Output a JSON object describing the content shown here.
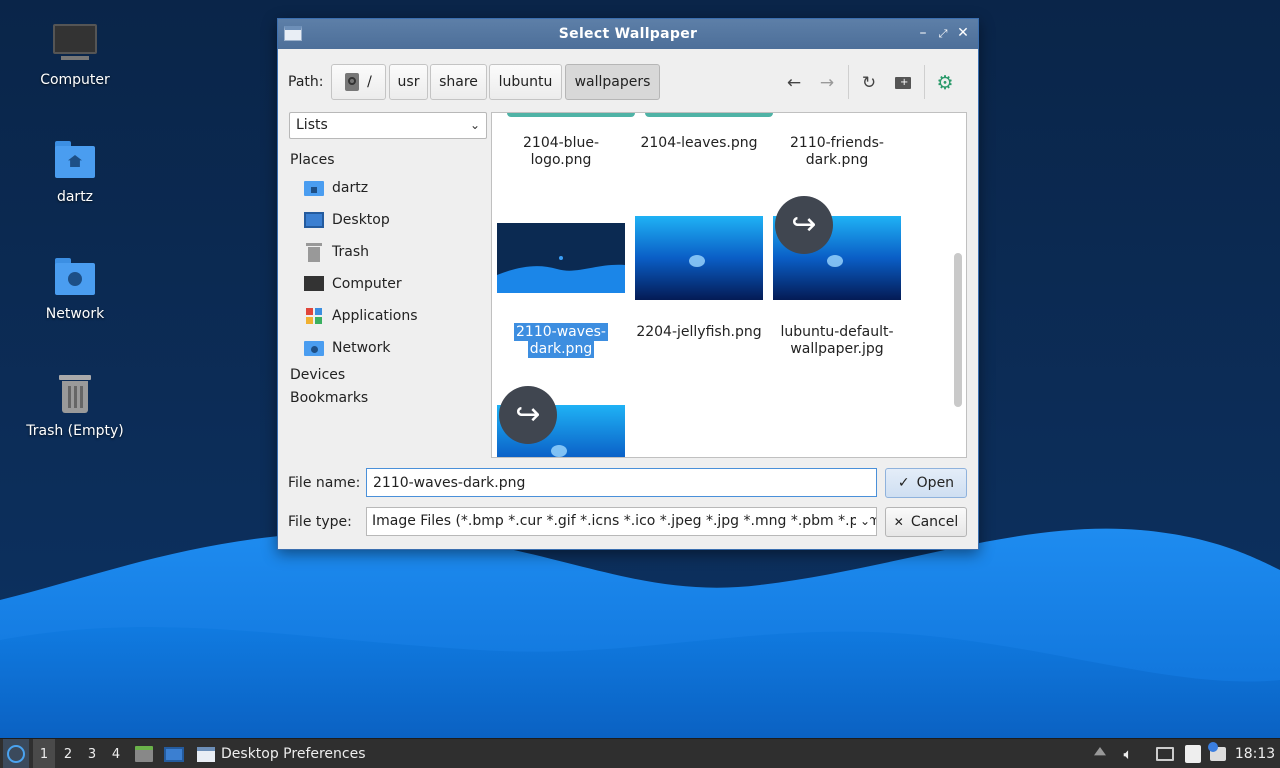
{
  "desktop": {
    "icons": [
      {
        "label": "Computer",
        "icon": "computer-icon"
      },
      {
        "label": "dartz",
        "icon": "home-folder-icon"
      },
      {
        "label": "Network",
        "icon": "network-folder-icon"
      },
      {
        "label": "Trash (Empty)",
        "icon": "trash-icon"
      }
    ]
  },
  "dialog": {
    "title": "Select Wallpaper",
    "path_label": "Path:",
    "breadcrumbs": [
      "/",
      "usr",
      "share",
      "lubuntu",
      "wallpapers"
    ],
    "view_mode": "Lists",
    "sidebar": {
      "places_header": "Places",
      "places": [
        "dartz",
        "Desktop",
        "Trash",
        "Computer",
        "Applications",
        "Network"
      ],
      "devices_header": "Devices",
      "bookmarks_header": "Bookmarks"
    },
    "files": [
      {
        "name_lines": [
          "2104-blue-",
          "logo.png"
        ]
      },
      {
        "name_lines": [
          "2104-leaves.png"
        ]
      },
      {
        "name_lines": [
          "2110-friends-",
          "dark.png"
        ]
      },
      {
        "name_lines": [
          "2110-waves-",
          "dark.png"
        ],
        "selected": true
      },
      {
        "name_lines": [
          "2204-jellyfish.png"
        ]
      },
      {
        "name_lines": [
          "lubuntu-default-",
          "wallpaper.jpg"
        ]
      },
      {
        "name_lines": []
      }
    ],
    "file_name_label": "File name:",
    "file_name_value": "2110-waves-dark.png",
    "file_type_label": "File type:",
    "file_type_value": "Image Files (*.bmp *.cur *.gif *.icns *.ico *.jpeg *.jpg *.mng *.pbm *.pgm",
    "open_label": "Open",
    "cancel_label": "Cancel"
  },
  "taskbar": {
    "workspaces": [
      "1",
      "2",
      "3",
      "4"
    ],
    "active_workspace": "1",
    "task_label": "Desktop Preferences",
    "clock": "18:13"
  },
  "colors": {
    "accent": "#3d8ee0",
    "titlebar": "#5576a0",
    "wallpaper_dark": "#0b2a52",
    "wallpaper_wave": "#1b86e8"
  }
}
